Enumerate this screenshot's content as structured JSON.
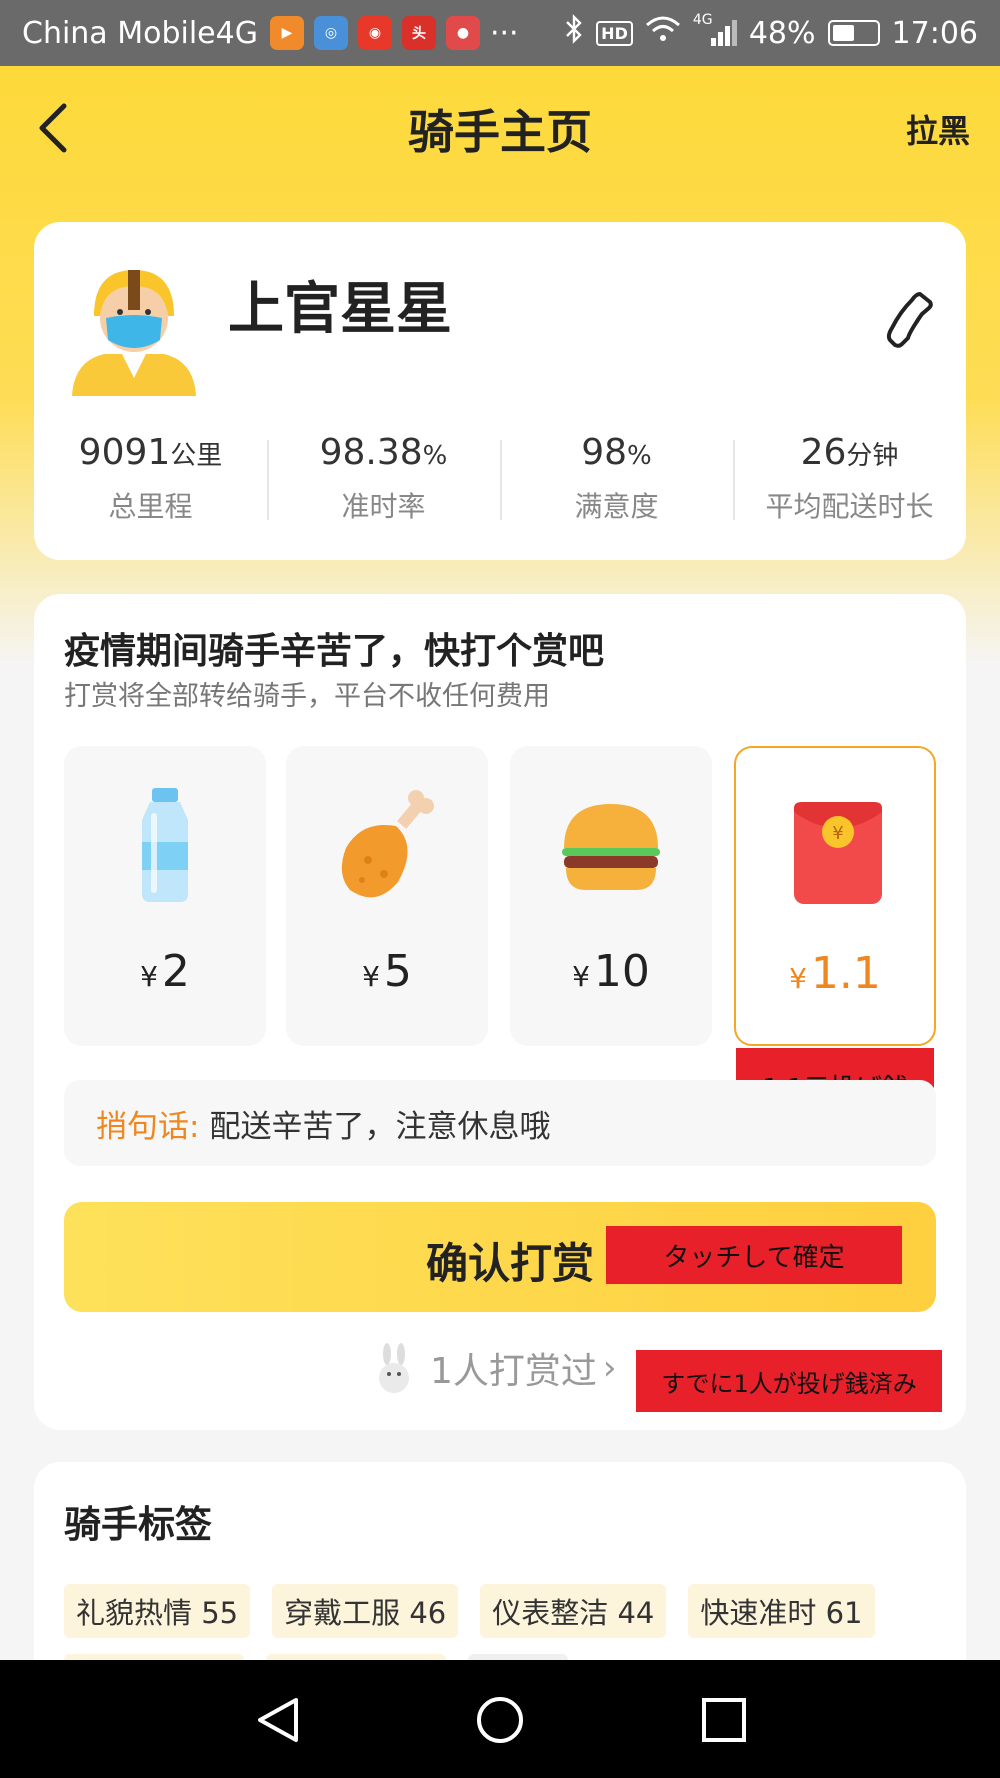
{
  "status_bar": {
    "carrier": "China Mobile4G",
    "more": "···",
    "hd": "HD",
    "network": "4G",
    "battery": "48%",
    "battery_level": 0.48,
    "time": "17:06"
  },
  "header": {
    "title": "骑手主页",
    "block_label": "拉黑"
  },
  "rider": {
    "name": "上官星星",
    "stats": [
      {
        "value": "9091",
        "unit": "公里",
        "label": "总里程"
      },
      {
        "value": "98.38",
        "unit": "%",
        "label": "准时率"
      },
      {
        "value": "98",
        "unit": "%",
        "label": "满意度"
      },
      {
        "value": "26",
        "unit": "分钟",
        "label": "平均配送时长"
      }
    ]
  },
  "tip": {
    "title": "疫情期间骑手辛苦了，快打个赏吧",
    "subtitle": "打赏将全部转给骑手，平台不收任何费用",
    "currency": "¥",
    "gifts": [
      {
        "icon": "water-bottle-icon",
        "amount": "2"
      },
      {
        "icon": "chicken-leg-icon",
        "amount": "5"
      },
      {
        "icon": "burger-icon",
        "amount": "10"
      },
      {
        "icon": "red-envelope-icon",
        "amount": "1.1",
        "selected": true
      }
    ],
    "message_label": "捎句话:",
    "message_text": "配送辛苦了，注意休息哦",
    "confirm_label": "确认打赏",
    "tipped_count_text": "1人打赏过",
    "tipped_chevron": "›"
  },
  "annotations": {
    "amount_note": "1.1元投げ銭",
    "confirm_note": "タッチして確定",
    "tipped_note": "すでに1人が投げ銭済み"
  },
  "tags": {
    "title": "骑手标签",
    "items": [
      "礼貌热情 55",
      "穿戴工服 46",
      "仪表整洁 44",
      "快速准时 61"
    ]
  },
  "colors": {
    "brand_yellow": "#fdd93a",
    "accent_orange": "#f0861e",
    "annotation_red": "#e8202a"
  }
}
